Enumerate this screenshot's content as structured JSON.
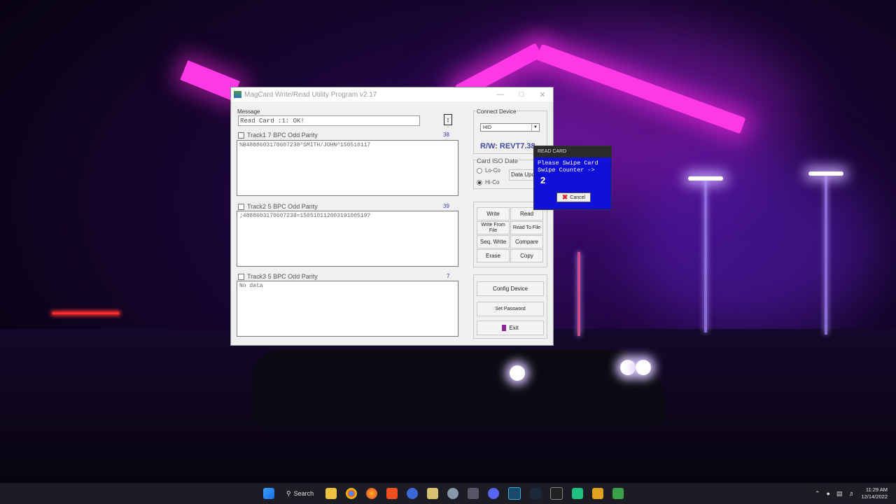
{
  "window": {
    "title": "MagCard Write/Read Utility Program v2.17"
  },
  "message": {
    "label": "Message",
    "value": "Read Card :1: OK!"
  },
  "tracks": [
    {
      "label": "Track1  7 BPC Odd Parity",
      "count": "38",
      "data": "%B4888603170607238^SMITH/JOHN^150510117"
    },
    {
      "label": "Track2  5 BPC Odd Parity",
      "count": "39",
      "data": ";4888603170607238=15051011200319100519?"
    },
    {
      "label": "Track3  5 BPC Odd Parity",
      "count": "7",
      "data": "No data"
    }
  ],
  "connect": {
    "label": "Connect Device",
    "device": "HID",
    "version": "R/W: REVT7.38"
  },
  "iso": {
    "label": "Card ISO Date",
    "lo": "Lo-Co",
    "hi": "Hi-Co",
    "update": "Data Upd"
  },
  "buttons": {
    "write": "Write",
    "read": "Read",
    "write_from_file": "Write From File",
    "read_to_file": "Read To File",
    "seq_write": "Seq. Write",
    "compare": "Compare",
    "erase": "Erase",
    "copy": "Copy",
    "config": "Config Device",
    "password": "Set Password",
    "exit": "Exit"
  },
  "popup": {
    "title": "READ CARD",
    "line1": "Please Swipe Card",
    "line2": "Swipe Counter ->",
    "counter": "2",
    "cancel": "Cancel"
  },
  "taskbar": {
    "search": "Search",
    "time": "11:29 AM",
    "date": "12/14/2022"
  },
  "colors": {
    "popup_bg": "#1010d8",
    "neon": "#ff38e6",
    "version_text": "#4a4aa8"
  }
}
